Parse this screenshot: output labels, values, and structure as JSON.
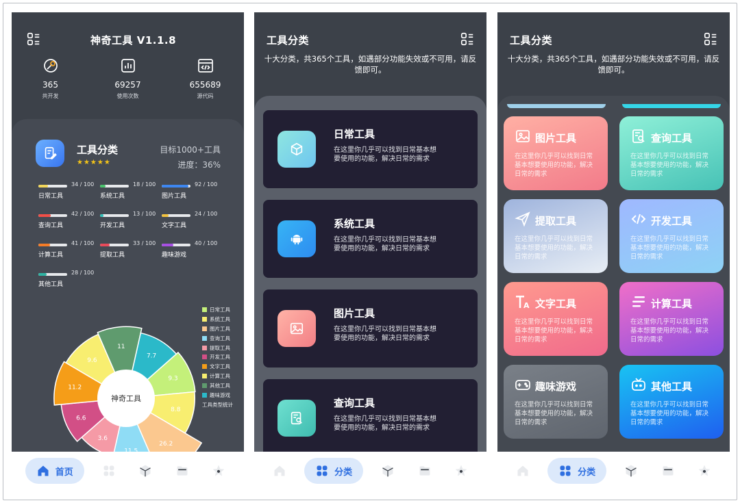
{
  "colors": {
    "screen_bg": "#3c4149",
    "accent_blue": "#2f6fe0",
    "nav_active_bg": "#dce9fb",
    "star": "#f5c518"
  },
  "home": {
    "title": "神奇工具 V1.1.8",
    "stats": [
      {
        "icon": "wrench-gear-icon",
        "value": "365",
        "label": "共开发"
      },
      {
        "icon": "chart-icon",
        "value": "69257",
        "label": "使用次数"
      },
      {
        "icon": "code-window-icon",
        "value": "655689",
        "label": "源代码"
      }
    ],
    "category_title": "工具分类",
    "goal": "目标1000+工具",
    "progress_text": "进度：36%",
    "stars": "★★★★★",
    "progress_items": [
      {
        "name": "日常工具",
        "value": "34 / 100",
        "pct": 34,
        "color": "#f1d65a"
      },
      {
        "name": "系统工具",
        "value": "18 / 100",
        "pct": 18,
        "color": "#48c26b"
      },
      {
        "name": "图片工具",
        "value": "92 / 100",
        "pct": 92,
        "color": "#3d86f0"
      },
      {
        "name": "查询工具",
        "value": "42 / 100",
        "pct": 42,
        "color": "#f24f47"
      },
      {
        "name": "开发工具",
        "value": "13 / 100",
        "pct": 13,
        "color": "#2fc0b8"
      },
      {
        "name": "文字工具",
        "value": "24 / 100",
        "pct": 24,
        "color": "#f2c23e"
      },
      {
        "name": "计算工具",
        "value": "41 / 100",
        "pct": 41,
        "color": "#f57c27"
      },
      {
        "name": "提取工具",
        "value": "33 / 100",
        "pct": 33,
        "color": "#e84a5a"
      },
      {
        "name": "趣味游戏",
        "value": "40 / 100",
        "pct": 40,
        "color": "#a74fe3"
      },
      {
        "name": "其他工具",
        "value": "28 / 100",
        "pct": 28,
        "color": "#2fb4a3"
      }
    ],
    "pie_center": "神奇工具",
    "legend_footer": "工具类型统计"
  },
  "chart_data": {
    "type": "pie",
    "variant": "rose",
    "center_label": "神奇工具",
    "legend_position": "right",
    "slices": [
      {
        "name": "日常工具",
        "value": 9.3,
        "color": "#c4f07a"
      },
      {
        "name": "系统工具",
        "value": 8.8,
        "color": "#f8ee70"
      },
      {
        "name": "图片工具",
        "value": 26.2,
        "color": "#fbc88f"
      },
      {
        "name": "查询工具",
        "value": 11.5,
        "color": "#8fdcf5"
      },
      {
        "name": "提取工具",
        "value": 3.6,
        "color": "#f59aa6"
      },
      {
        "name": "开发工具",
        "value": 6.6,
        "color": "#d24f86"
      },
      {
        "name": "文字工具",
        "value": 11.2,
        "color": "#f59d18"
      },
      {
        "name": "计算工具",
        "value": 9.6,
        "color": "#f8ee70"
      },
      {
        "name": "其他工具",
        "value": 11.0,
        "color": "#5f9b6e"
      },
      {
        "name": "趣味游戏",
        "value": 7.7,
        "color": "#2bb9c9"
      }
    ],
    "legend": [
      {
        "name": "日常工具",
        "color": "#c4f07a"
      },
      {
        "name": "系统工具",
        "color": "#f8ee70"
      },
      {
        "name": "图片工具",
        "color": "#fbc88f"
      },
      {
        "name": "查询工具",
        "color": "#8fdcf5"
      },
      {
        "name": "提取工具",
        "color": "#f59aa6"
      },
      {
        "name": "开发工具",
        "color": "#d24f86"
      },
      {
        "name": "文字工具",
        "color": "#f59d18"
      },
      {
        "name": "计算工具",
        "color": "#f8ee70"
      },
      {
        "name": "其他工具",
        "color": "#5f9b6e"
      },
      {
        "name": "趣味游戏",
        "color": "#2bb9c9"
      }
    ]
  },
  "category_page": {
    "title": "工具分类",
    "desc": "十大分类，共365个工具，如遇部分功能失效或不可用，请反馈即可。",
    "cards": [
      {
        "name": "日常工具",
        "desc": "在这里你几乎可以找到日常基本想要使用的功能，解决日常的需求",
        "icon": "cube-icon",
        "grad": "linear-gradient(135deg,#8ee6e0,#6fc6f0)"
      },
      {
        "name": "系统工具",
        "desc": "在这里你几乎可以找到日常基本想要使用的功能，解决日常的需求",
        "icon": "android-icon",
        "grad": "linear-gradient(135deg,#37b4f5,#2e8cf0)"
      },
      {
        "name": "图片工具",
        "desc": "在这里你几乎可以找到日常基本想要使用的功能，解决日常的需求",
        "icon": "image-icon",
        "grad": "linear-gradient(135deg,#ffb3a7,#f27f86)"
      },
      {
        "name": "查询工具",
        "desc": "在这里你几乎可以找到日常基本想要使用的功能，解决日常的需求",
        "icon": "search-doc-icon",
        "grad": "linear-gradient(135deg,#6fe0d0,#3fbcb0)"
      }
    ]
  },
  "grid_page": {
    "title": "工具分类",
    "desc": "十大分类，共365个工具，如遇部分功能失效或不可用，请反馈即可。",
    "cards": [
      {
        "name": "图片工具",
        "desc": "在这里你几乎可以找到日常基本想要使用的功能，解决日常的需求",
        "icon": "image-icon",
        "grad": "linear-gradient(160deg,#ffb0a4,#f27b8a)"
      },
      {
        "name": "查询工具",
        "desc": "在这里你几乎可以找到日常基本想要使用的功能，解决日常的需求",
        "icon": "search-doc-icon",
        "grad": "linear-gradient(160deg,#8ff0d8,#47c2b6)"
      },
      {
        "name": "提取工具",
        "desc": "在这里你几乎可以找到日常基本想要使用的功能，解决日常的需求",
        "icon": "send-icon",
        "grad": "linear-gradient(160deg,#9fb4dd,#e8eef5)"
      },
      {
        "name": "开发工具",
        "desc": "在这里你几乎可以找到日常基本想要使用的功能，解决日常的需求",
        "icon": "code-icon",
        "grad": "linear-gradient(160deg,#9fb8ff,#8ed2f5)"
      },
      {
        "name": "文字工具",
        "desc": "在这里你几乎可以找到日常基本想要使用的功能，解决日常的需求",
        "icon": "text-icon",
        "grad": "linear-gradient(160deg,#ff9a8e,#f06a8c)"
      },
      {
        "name": "计算工具",
        "desc": "在这里你几乎可以找到日常基本想要使用的功能，解决日常的需求",
        "icon": "bars-icon",
        "grad": "linear-gradient(160deg,#f06fc8,#8c4fe0)"
      },
      {
        "name": "趣味游戏",
        "desc": "在这里你几乎可以找到日常基本想要使用的功能，解决日常的需求",
        "icon": "gamepad-icon",
        "grad": "linear-gradient(160deg,#7a8088,#5f656e)"
      },
      {
        "name": "其他工具",
        "desc": "在这里你几乎可以找到日常基本想要使用的功能，解决日常的需求",
        "icon": "tv-icon",
        "grad": "linear-gradient(160deg,#19c3f2,#1f5ff0)"
      }
    ]
  },
  "nav": {
    "home_label": "首页",
    "category_label": "分类",
    "items": [
      "home-icon",
      "grid-icon",
      "cube-icon",
      "folder-icon",
      "star-icon"
    ]
  }
}
